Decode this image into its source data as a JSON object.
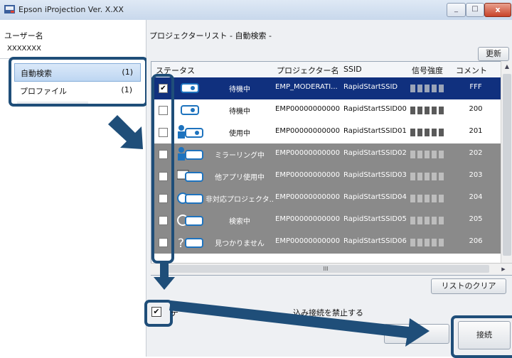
{
  "window": {
    "title": "Epson iProjection Ver. X.XX"
  },
  "left": {
    "username_label": "ユーザー名",
    "username_value": "XXXXXXX",
    "nav": [
      {
        "label": "自動検索",
        "count": "(1)"
      },
      {
        "label": "プロファイル",
        "count": "(1)"
      }
    ]
  },
  "right": {
    "list_title": "プロジェクターリスト - 自動検索 -",
    "refresh_button": "更新",
    "columns": [
      "ステータス",
      "プロジェクター名",
      "SSID",
      "信号強度",
      "コメント"
    ],
    "rows": [
      {
        "checked": true,
        "status": "待機中",
        "name": "EMP_MODERATI...",
        "ssid": "RapidStartSSID",
        "comment": "FFF",
        "style": "sel",
        "icon": "projector-icon"
      },
      {
        "checked": false,
        "status": "待機中",
        "name": "EMP00000000000...",
        "ssid": "RapidStartSSID00",
        "comment": "200",
        "style": "white",
        "icon": "projector-icon"
      },
      {
        "checked": false,
        "status": "使用中",
        "name": "EMP00000000000...",
        "ssid": "RapidStartSSID01",
        "comment": "201",
        "style": "white",
        "icon": "user-projector-icon"
      },
      {
        "checked": false,
        "status": "ミラーリング中",
        "name": "EMP00000000000...",
        "ssid": "RapidStartSSID02",
        "comment": "202",
        "style": "gray",
        "icon": "mirroring-projector-icon"
      },
      {
        "checked": false,
        "status": "他アプリ使用中",
        "name": "EMP00000000000...",
        "ssid": "RapidStartSSID03",
        "comment": "203",
        "style": "gray",
        "icon": "monitor-projector-icon"
      },
      {
        "checked": false,
        "status": "非対応プロジェクタ...",
        "name": "EMP00000000000...",
        "ssid": "RapidStartSSID04",
        "comment": "204",
        "style": "gray",
        "icon": "unsupported-projector-icon"
      },
      {
        "checked": false,
        "status": "検索中",
        "name": "EMP00000000000...",
        "ssid": "RapidStartSSID05",
        "comment": "205",
        "style": "gray",
        "icon": "searching-projector-icon"
      },
      {
        "checked": false,
        "status": "見つかりません",
        "name": "EMP00000000000...",
        "ssid": "RapidStartSSID06",
        "comment": "206",
        "style": "gray",
        "icon": "not-found-projector-icon"
      }
    ],
    "scroll_ellipsis": "III",
    "clear_list_button": "リストのクリア",
    "checkbox_text_start": "デ",
    "checkbox_text_end": "込み接続を禁止する",
    "connect_button": "接続"
  },
  "colors": {
    "accent_dark": "#1f4e79",
    "selected_row": "#10307e",
    "gray_row": "#8a8a8a",
    "signal_on": "#5a5a5a"
  }
}
